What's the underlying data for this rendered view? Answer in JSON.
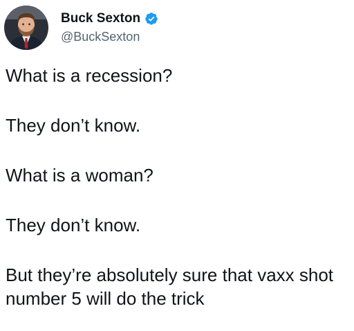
{
  "tweet": {
    "author": {
      "display_name": "Buck Sexton",
      "handle": "@BuckSexton",
      "verified": true,
      "verified_color": "#1d9bf0"
    },
    "paragraphs": [
      "What is a recession?",
      "They don’t know.",
      "What is a woman?",
      "They don’t know.",
      "But they’re absolutely sure that vaxx shot number 5 will do the trick"
    ]
  }
}
